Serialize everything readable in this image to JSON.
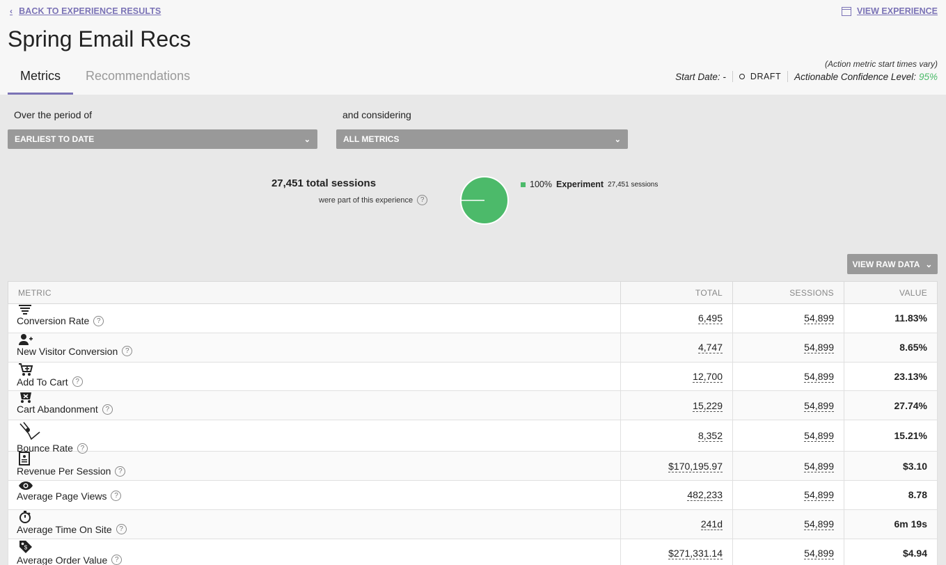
{
  "header": {
    "back_label": "BACK TO EXPERIENCE RESULTS",
    "view_experience_label": "VIEW EXPERIENCE",
    "title": "Spring Email Recs",
    "tabs": [
      "Metrics",
      "Recommendations"
    ],
    "note": "(Action metric start times vary)",
    "start_date_label": "Start Date: -",
    "status": "DRAFT",
    "confidence_label": "Actionable Confidence Level:",
    "confidence_value": "95%"
  },
  "filters": {
    "period_label": "Over the period of",
    "period_value": "EARLIEST TO DATE",
    "considering_label": "and considering",
    "considering_value": "ALL METRICS"
  },
  "summary": {
    "total_sessions": "27,451 total sessions",
    "sub": "were part of this experience",
    "legend_pct": "100%",
    "legend_name": "Experiment",
    "legend_sessions": "27,451 sessions",
    "pie_color": "#4cba6a",
    "pie_fraction": 1.0
  },
  "raw_button_label": "VIEW RAW DATA",
  "table": {
    "headers": [
      "METRIC",
      "TOTAL",
      "SESSIONS",
      "VALUE"
    ],
    "rows": [
      {
        "icon": "funnel-icon",
        "metric": "Conversion Rate",
        "total": "6,495",
        "sessions": "54,899",
        "value": "11.83%"
      },
      {
        "icon": "add-user-icon",
        "metric": "New Visitor Conversion",
        "total": "4,747",
        "sessions": "54,899",
        "value": "8.65%"
      },
      {
        "icon": "add-cart-icon",
        "metric": "Add To Cart",
        "total": "12,700",
        "sessions": "54,899",
        "value": "23.13%"
      },
      {
        "icon": "cart-abandon-icon",
        "metric": "Cart Abandonment",
        "total": "15,229",
        "sessions": "54,899",
        "value": "27.74%"
      },
      {
        "icon": "bounce-icon",
        "metric": "Bounce Rate",
        "total": "8,352",
        "sessions": "54,899",
        "value": "15.21%"
      },
      {
        "icon": "receipt-icon",
        "metric": "Revenue Per Session",
        "total": "$170,195.97",
        "sessions": "54,899",
        "value": "$3.10"
      },
      {
        "icon": "eye-icon",
        "metric": "Average Page Views",
        "total": "482,233",
        "sessions": "54,899",
        "value": "8.78"
      },
      {
        "icon": "stopwatch-icon",
        "metric": "Average Time On Site",
        "total": "241d",
        "sessions": "54,899",
        "value": "6m 19s"
      },
      {
        "icon": "price-tag-icon",
        "metric": "Average Order Value",
        "total": "$271,331.14",
        "sessions": "54,899",
        "value": "$4.94"
      }
    ]
  }
}
